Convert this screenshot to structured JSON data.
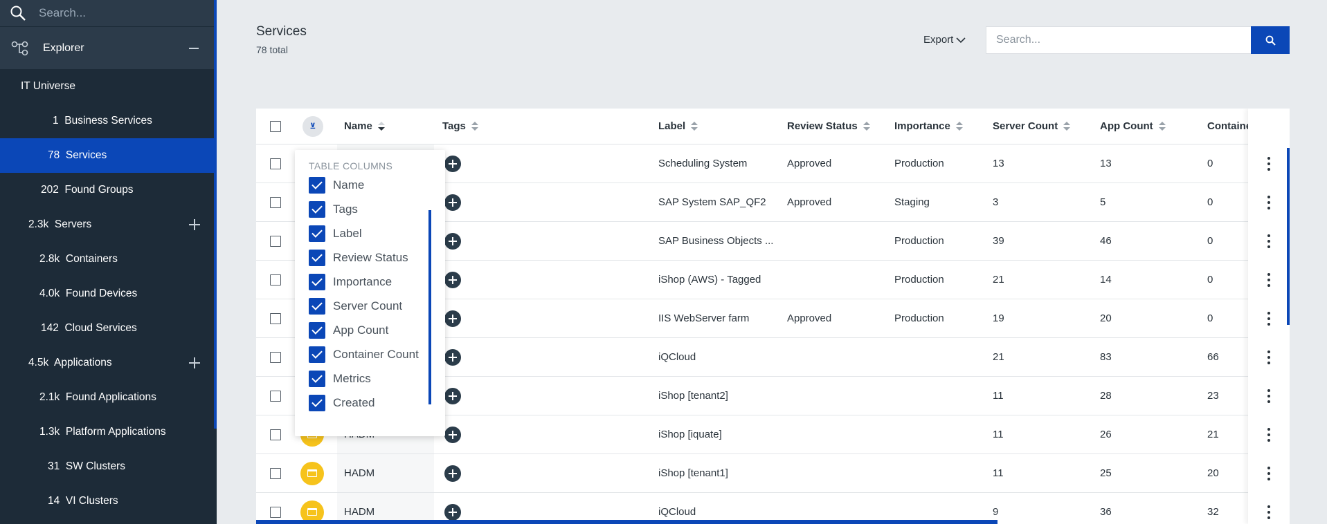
{
  "sidebar": {
    "search_placeholder": "Search...",
    "explorer_label": "Explorer",
    "items": [
      {
        "label": "IT Universe",
        "indent": 30
      },
      {
        "label": "1  Business Services",
        "indent": 76
      },
      {
        "label": "78  Services",
        "indent": 69,
        "selected": true
      },
      {
        "label": "202  Found Groups",
        "indent": 59
      },
      {
        "label": "2.3k  Servers",
        "indent": 41,
        "expandable": true
      },
      {
        "label": "2.8k  Containers",
        "indent": 57
      },
      {
        "label": "4.0k  Found Devices",
        "indent": 57
      },
      {
        "label": "142  Cloud Services",
        "indent": 59
      },
      {
        "label": "4.5k  Applications",
        "indent": 41,
        "expandable": true
      },
      {
        "label": "2.1k  Found Applications",
        "indent": 57
      },
      {
        "label": "1.3k  Platform Applications",
        "indent": 57
      },
      {
        "label": "31  SW Clusters",
        "indent": 69
      },
      {
        "label": "14  VI Clusters",
        "indent": 69
      }
    ]
  },
  "header": {
    "title": "Services",
    "subtitle": "78 total",
    "export_label": "Export",
    "search_placeholder": "Search..."
  },
  "table": {
    "columns": [
      "Name",
      "Tags",
      "Label",
      "Review Status",
      "Importance",
      "Server Count",
      "App Count",
      "Containe"
    ],
    "rows": [
      {
        "name": "",
        "label": "Scheduling System",
        "review": "Approved",
        "importance": "Production",
        "servers": "13",
        "apps": "13",
        "containers": "0",
        "icon": false
      },
      {
        "name": "",
        "label": "SAP System SAP_QF2",
        "review": "Approved",
        "importance": "Staging",
        "servers": "3",
        "apps": "5",
        "containers": "0",
        "icon": false
      },
      {
        "name": "",
        "label": "SAP Business Objects ...",
        "review": "",
        "importance": "Production",
        "servers": "39",
        "apps": "46",
        "containers": "0",
        "icon": false
      },
      {
        "name": "",
        "label": "iShop (AWS) - Tagged",
        "review": "",
        "importance": "Production",
        "servers": "21",
        "apps": "14",
        "containers": "0",
        "icon": false
      },
      {
        "name": "",
        "label": "IIS WebServer farm",
        "review": "Approved",
        "importance": "Production",
        "servers": "19",
        "apps": "20",
        "containers": "0",
        "icon": false
      },
      {
        "name": "",
        "label": "iQCloud",
        "review": "",
        "importance": "",
        "servers": "21",
        "apps": "83",
        "containers": "66",
        "icon": false
      },
      {
        "name": "",
        "label": "iShop [tenant2]",
        "review": "",
        "importance": "",
        "servers": "11",
        "apps": "28",
        "containers": "23",
        "icon": false
      },
      {
        "name": "HADM",
        "label": "iShop [iquate]",
        "review": "",
        "importance": "",
        "servers": "11",
        "apps": "26",
        "containers": "21",
        "icon": true
      },
      {
        "name": "HADM",
        "label": "iShop [tenant1]",
        "review": "",
        "importance": "",
        "servers": "11",
        "apps": "25",
        "containers": "20",
        "icon": true
      },
      {
        "name": "HADM",
        "label": "iQCloud",
        "review": "",
        "importance": "",
        "servers": "9",
        "apps": "36",
        "containers": "32",
        "icon": true
      }
    ]
  },
  "columns_menu": {
    "title": "TABLE COLUMNS",
    "items": [
      "Name",
      "Tags",
      "Label",
      "Review Status",
      "Importance",
      "Server Count",
      "App Count",
      "Container Count",
      "Metrics",
      "Created"
    ]
  },
  "colors": {
    "sidebar_bg": "#1d2b38",
    "accent": "#0b47b7",
    "service_icon": "#f6c31c"
  }
}
